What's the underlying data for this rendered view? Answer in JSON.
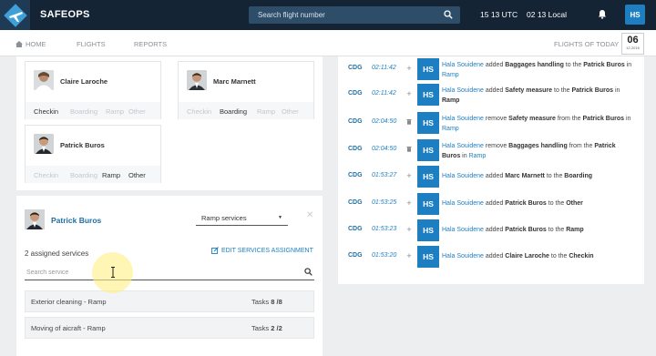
{
  "app": {
    "brand": "SAFEOPS",
    "search_placeholder": "Search flight number",
    "clock_utc": "15  13 UTC",
    "clock_local": "02  13 Local",
    "user_initials": "HS"
  },
  "nav": {
    "home": "HOME",
    "flights": "FLIGHTS",
    "reports": "REPORTS",
    "flights_today": "FLIGHTS OF TODAY",
    "date_day": "06",
    "date_full": "12-2016"
  },
  "agents": [
    {
      "name": "Claire Laroche",
      "stations": [
        "Checkin",
        "Boarding",
        "Ramp",
        "Other"
      ],
      "active": "Checkin"
    },
    {
      "name": "Marc Marnett",
      "stations": [
        "Checkin",
        "Boarding",
        "Ramp",
        "Other"
      ],
      "active": "Boarding"
    },
    {
      "name": "Patrick Buros",
      "stations": [
        "Checkin",
        "Boarding",
        "Ramp",
        "Other"
      ],
      "active": "Ramp,Other"
    }
  ],
  "detail": {
    "name": "Patrick Buros",
    "select_value": "Ramp services",
    "assigned_text": "2 assigned services",
    "edit_label": "EDIT SERVICES ASSIGNMENT",
    "search_placeholder": "Search service",
    "services": [
      {
        "name": "Exterior cleaning - Ramp",
        "tasks_label": "Tasks",
        "done": "8",
        "total": "/8"
      },
      {
        "name": "Moving of aicraft - Ramp",
        "tasks_label": "Tasks",
        "done": "2",
        "total": "/2"
      }
    ]
  },
  "log": [
    {
      "airport": "CDG",
      "time": "02:11:42",
      "action": "+",
      "initials": "HS",
      "user": "Hala Souidene",
      "verb": " added ",
      "item": "Baggages handling",
      "prep": " to the ",
      "target": "Patrick Buros",
      "in": " in ",
      "loc": "Ramp"
    },
    {
      "airport": "CDG",
      "time": "02:11:42",
      "action": "+",
      "initials": "HS",
      "user": "Hala Souidene",
      "verb": " added ",
      "item": "Safety measure",
      "prep": " to the ",
      "target": "Patrick Buros",
      "in": " in ",
      "loc": "Ramp"
    },
    {
      "airport": "CDG",
      "time": "02:04:50",
      "action": "trash",
      "initials": "HS",
      "user": "Hala Souidene",
      "verb": " remove ",
      "item": "Safety measure",
      "prep": " from the ",
      "target": "Patrick Buros",
      "in": " in ",
      "loc": "Ramp"
    },
    {
      "airport": "CDG",
      "time": "02:04:50",
      "action": "trash",
      "initials": "HS",
      "user": "Hala Souidene",
      "verb": " remove ",
      "item": "Baggages handling",
      "prep": " from the ",
      "target": "Patrick Buros",
      "in": " in ",
      "loc": "Ramp"
    },
    {
      "airport": "CDG",
      "time": "01:53:27",
      "action": "+",
      "initials": "HS",
      "user": "Hala Souidene",
      "verb": " added ",
      "item": "Marc Marnett",
      "prep": " to the ",
      "target": "Boarding",
      "in": "",
      "loc": ""
    },
    {
      "airport": "CDG",
      "time": "01:53:25",
      "action": "+",
      "initials": "HS",
      "user": "Hala Souidene",
      "verb": " added ",
      "item": "Patrick Buros",
      "prep": " to the ",
      "target": "Other",
      "in": "",
      "loc": ""
    },
    {
      "airport": "CDG",
      "time": "01:53:23",
      "action": "+",
      "initials": "HS",
      "user": "Hala Souidene",
      "verb": " added ",
      "item": "Patrick Buros",
      "prep": " to the ",
      "target": "Ramp",
      "in": "",
      "loc": ""
    },
    {
      "airport": "CDG",
      "time": "01:53:20",
      "action": "+",
      "initials": "HS",
      "user": "Hala Souidene",
      "verb": " added ",
      "item": "Claire Laroche",
      "prep": " to the ",
      "target": "Checkin",
      "in": "",
      "loc": ""
    }
  ],
  "colors": {
    "topbar": "#142435",
    "accent": "#1d7fc1",
    "link": "#1d6fa5"
  }
}
